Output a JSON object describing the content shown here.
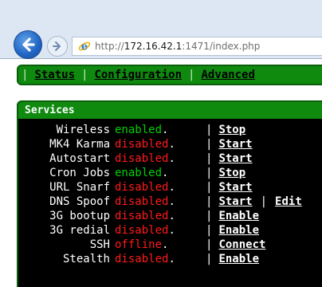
{
  "browser": {
    "url_prefix": "http://",
    "url_host": "172.16.42.1",
    "url_rest": ":1471/index.php"
  },
  "nav": {
    "items": [
      {
        "label": "Status"
      },
      {
        "label": "Configuration"
      },
      {
        "label": "Advanced"
      }
    ],
    "separator": "|"
  },
  "services": {
    "title": "Services",
    "rows": [
      {
        "name": "Wireless",
        "status": "enabled",
        "status_color": "#00d000",
        "dot": ".",
        "actions": [
          "Stop"
        ]
      },
      {
        "name": "MK4 Karma",
        "status": "disabled",
        "status_color": "#ff1a1a",
        "dot": ".",
        "actions": [
          "Start"
        ]
      },
      {
        "name": "Autostart",
        "status": "disabled",
        "status_color": "#ff1a1a",
        "dot": ".",
        "actions": [
          "Start"
        ]
      },
      {
        "name": "Cron Jobs",
        "status": "enabled",
        "status_color": "#00d000",
        "dot": ".",
        "actions": [
          "Stop"
        ]
      },
      {
        "name": "URL Snarf",
        "status": "disabled",
        "status_color": "#ff1a1a",
        "dot": ".",
        "actions": [
          "Start"
        ]
      },
      {
        "name": "DNS Spoof",
        "status": "disabled",
        "status_color": "#ff1a1a",
        "dot": ".",
        "actions": [
          "Start",
          "Edit"
        ]
      },
      {
        "name": "3G bootup",
        "status": "disabled",
        "status_color": "#ff1a1a",
        "dot": ".",
        "actions": [
          "Enable"
        ]
      },
      {
        "name": "3G redial",
        "status": "disabled",
        "status_color": "#ff1a1a",
        "dot": ".",
        "actions": [
          "Enable"
        ]
      },
      {
        "name": "SSH",
        "status": "offline",
        "status_color": "#ff1a1a",
        "dot": ".",
        "actions": [
          "Connect"
        ]
      },
      {
        "name": "Stealth",
        "status": "disabled",
        "status_color": "#ff1a1a",
        "dot": ".",
        "actions": [
          "Enable"
        ]
      }
    ],
    "pipe": "|"
  },
  "colors": {
    "nav_green": "#0f8a0f",
    "enabled": "#00d000",
    "disabled": "#ff1a1a"
  },
  "icons": {
    "back": "back-arrow-icon",
    "forward": "forward-arrow-icon",
    "ie": "internet-explorer-icon"
  }
}
